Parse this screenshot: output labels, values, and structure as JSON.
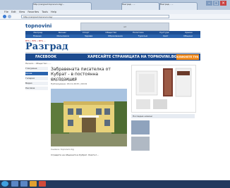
{
  "browser": {
    "tabs": [
      "http://razgrad.topnovini.bg/...",
      "Разград - ...",
      "Разград - ..."
    ],
    "url": "http://razgrad.topnovini.bg/",
    "menu": [
      "File",
      "Edit",
      "View",
      "Favorites",
      "Tools",
      "Help"
    ]
  },
  "site": {
    "logo": "topnovini",
    "nav_row1": [
      "Разград",
      "Бизнес",
      "Спорт",
      "Общество",
      "Политика",
      "Култура",
      "Крими"
    ],
    "nav_row2": [
      "Новини",
      "Икономика",
      "Здраве",
      "Образование",
      "Туризъм",
      "Свят",
      "Общини"
    ],
    "section_title": "Разград",
    "facebook_label": "FACEBOOK",
    "facebook_cta": "ХАРЕСАЙТЕ СТРАНИЦАТА НА TOPNOVINI.BG",
    "facebook_click": "КЛИКНЕТЕ ТУК",
    "breadcrumb": "Начало › Общество › ...",
    "ticker": "BTS • BTS • BTS ..."
  },
  "left_sidebar": [
    "Гласуване",
    "Архив",
    "Галерия",
    "Видео",
    "Реклама"
  ],
  "article": {
    "title": "Забравената писателка от Кубрат - в постоянна експозиция",
    "author": "Автор: Лидия Гърбова",
    "date": "Публикувана: 29.11.2015 | 09:01",
    "caption": "Снимка: topnovini.bg",
    "body": "Сградата на общината в Кубрат. Кметът..."
  },
  "right_sidebar": {
    "box_title": "Последни новини"
  },
  "colors": {
    "nav_blue": "#1f4f93",
    "fb_blue": "#1d4b8f",
    "cta_orange": "#f28c1e",
    "taskbar": "#223a5e"
  }
}
